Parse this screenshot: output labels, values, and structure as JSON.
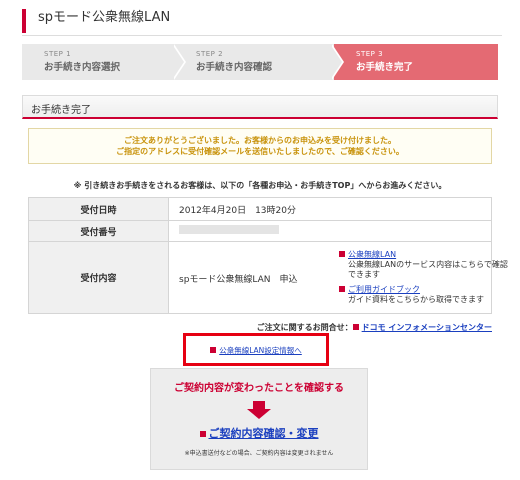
{
  "header": {
    "title": "spモード公衆無線LAN"
  },
  "steps": [
    {
      "num": "STEP 1",
      "label": "お手続き内容選択"
    },
    {
      "num": "STEP 2",
      "label": "お手続き内容確認"
    },
    {
      "num": "STEP 3",
      "label": "お手続き完了"
    }
  ],
  "section": {
    "title": "お手続き完了"
  },
  "notice": {
    "line1": "ご注文ありがとうございました。お客様からのお申込みを受け付けました。",
    "line2": "ご指定のアドレスに受付確認メールを送信いたしましたので、ご確認ください。"
  },
  "note": "※ 引き続きお手続きをされるお客様は、以下の「各種お申込・お手続きTOP」へからお進みください。",
  "table": {
    "row1": {
      "key": "受付日時",
      "value": "2012年4月20日　13時20分"
    },
    "row2": {
      "key": "受付番号"
    },
    "row3": {
      "key": "受付内容",
      "value": "spモード公衆無線LAN　申込",
      "link1": {
        "label": "公衆無線LAN",
        "desc": "公衆無線LANのサービス内容はこちらで確認できます"
      },
      "link2": {
        "label": "ご利用ガイドブック",
        "desc": "ガイド資料をこちらから取得できます"
      }
    }
  },
  "inquiry": {
    "label": "ご注文に関するお問合せ：",
    "link": "ドコモ インフォメーションセンター"
  },
  "settings": {
    "link": "公衆無線LAN設定情報へ"
  },
  "confirm": {
    "heading": "ご契約内容が変わったことを確認する",
    "link": "ご契約内容確認・変更",
    "fine": "※申込書送付などの場合、ご契約内容は変更されません"
  },
  "colors": {
    "accent": "#cc0033",
    "highlight": "#e60012",
    "step_active": "#e46a73",
    "link": "#1a3fbf",
    "notice_text": "#c8920a"
  }
}
